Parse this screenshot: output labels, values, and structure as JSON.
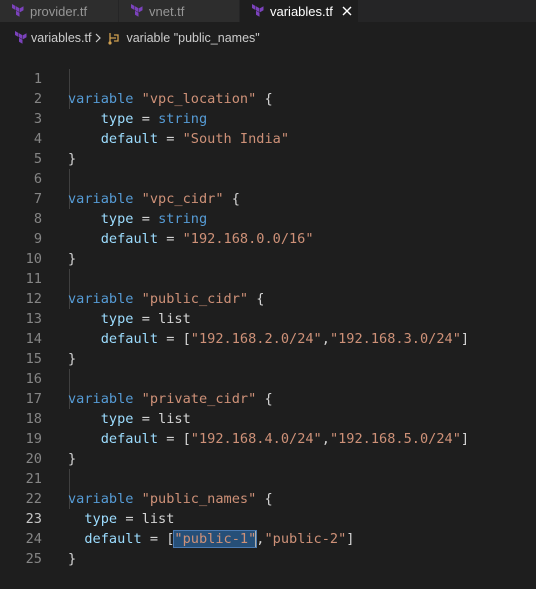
{
  "tabs": [
    {
      "label": "provider.tf",
      "active": false
    },
    {
      "label": "vnet.tf",
      "active": false
    },
    {
      "label": "variables.tf",
      "active": true
    }
  ],
  "breadcrumb": {
    "file": "variables.tf",
    "symbol": "variable \"public_names\""
  },
  "colors": {
    "terraform_icon": "#7b42bc",
    "symbol_icon": "#d0a050",
    "keyword": "#569cd6",
    "string": "#ce9178",
    "attribute": "#9cdcfe"
  },
  "editor": {
    "line_numbers": [
      "1",
      "2",
      "3",
      "4",
      "5",
      "6",
      "7",
      "8",
      "9",
      "10",
      "11",
      "12",
      "13",
      "14",
      "15",
      "16",
      "17",
      "18",
      "19",
      "20",
      "21",
      "22",
      "23",
      "24",
      "25"
    ],
    "current_line": "23",
    "code": {
      "v1": {
        "kw": "variable",
        "name": "\"vpc_location\"",
        "open": "{"
      },
      "v1_type": {
        "key": "type",
        "eq": "=",
        "val": "string"
      },
      "v1_default": {
        "key": "default",
        "eq": "=",
        "val": "\"South India\""
      },
      "v2": {
        "kw": "variable",
        "name": "\"vpc_cidr\"",
        "open": "{"
      },
      "v2_type": {
        "key": "type",
        "eq": "=",
        "val": "string"
      },
      "v2_default": {
        "key": "default",
        "eq": "=",
        "val": "\"192.168.0.0/16\""
      },
      "v3": {
        "kw": "variable",
        "name": "\"public_cidr\"",
        "open": "{"
      },
      "v3_type": {
        "key": "type",
        "eq": "=",
        "val": "list"
      },
      "v3_default": {
        "key": "default",
        "eq": "=",
        "ob": "[",
        "v1": "\"192.168.2.0/24\"",
        "comma": ",",
        "v2": "\"192.168.3.0/24\"",
        "cb": "]"
      },
      "v4": {
        "kw": "variable",
        "name": "\"private_cidr\"",
        "open": "{"
      },
      "v4_type": {
        "key": "type",
        "eq": "=",
        "val": "list"
      },
      "v4_default": {
        "key": "default",
        "eq": "=",
        "ob": "[",
        "v1": "\"192.168.4.0/24\"",
        "comma": ",",
        "v2": "\"192.168.5.0/24\"",
        "cb": "]"
      },
      "v5": {
        "kw": "variable",
        "name": "\"public_names\"",
        "open": "{"
      },
      "v5_type": {
        "key": "type",
        "eq": "=",
        "val": "list"
      },
      "v5_default": {
        "key": "default",
        "eq": "=",
        "ob": "[",
        "v1": "\"public-1\"",
        "comma": ",",
        "v2": "\"public-2\"",
        "cb": "]"
      },
      "close": "}"
    }
  }
}
